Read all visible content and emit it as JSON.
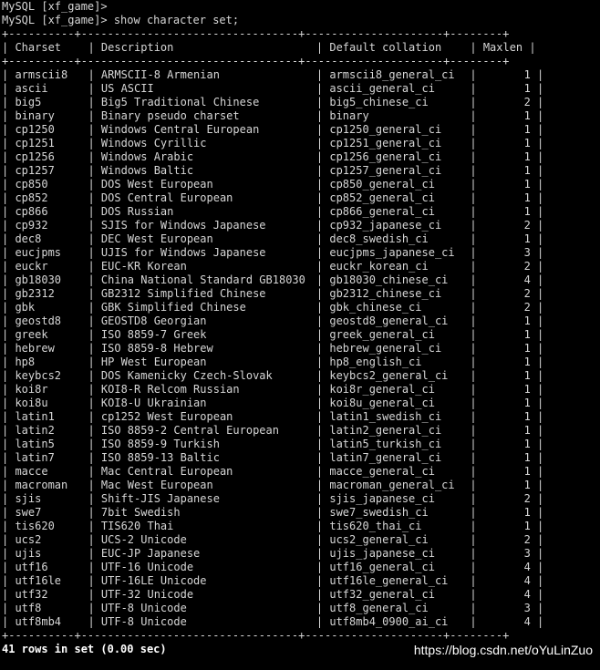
{
  "prompt_lines": [
    "MySQL [xf_game]>",
    "MySQL [xf_game]> show character set;"
  ],
  "table": {
    "border": "+----------+---------------------------------+---------------------+--------+",
    "headers": [
      "Charset",
      "Description",
      "Default collation",
      "Maxlen"
    ],
    "rows": [
      [
        "armscii8",
        "ARMSCII-8 Armenian",
        "armscii8_general_ci",
        "1"
      ],
      [
        "ascii",
        "US ASCII",
        "ascii_general_ci",
        "1"
      ],
      [
        "big5",
        "Big5 Traditional Chinese",
        "big5_chinese_ci",
        "2"
      ],
      [
        "binary",
        "Binary pseudo charset",
        "binary",
        "1"
      ],
      [
        "cp1250",
        "Windows Central European",
        "cp1250_general_ci",
        "1"
      ],
      [
        "cp1251",
        "Windows Cyrillic",
        "cp1251_general_ci",
        "1"
      ],
      [
        "cp1256",
        "Windows Arabic",
        "cp1256_general_ci",
        "1"
      ],
      [
        "cp1257",
        "Windows Baltic",
        "cp1257_general_ci",
        "1"
      ],
      [
        "cp850",
        "DOS West European",
        "cp850_general_ci",
        "1"
      ],
      [
        "cp852",
        "DOS Central European",
        "cp852_general_ci",
        "1"
      ],
      [
        "cp866",
        "DOS Russian",
        "cp866_general_ci",
        "1"
      ],
      [
        "cp932",
        "SJIS for Windows Japanese",
        "cp932_japanese_ci",
        "2"
      ],
      [
        "dec8",
        "DEC West European",
        "dec8_swedish_ci",
        "1"
      ],
      [
        "eucjpms",
        "UJIS for Windows Japanese",
        "eucjpms_japanese_ci",
        "3"
      ],
      [
        "euckr",
        "EUC-KR Korean",
        "euckr_korean_ci",
        "2"
      ],
      [
        "gb18030",
        "China National Standard GB18030",
        "gb18030_chinese_ci",
        "4"
      ],
      [
        "gb2312",
        "GB2312 Simplified Chinese",
        "gb2312_chinese_ci",
        "2"
      ],
      [
        "gbk",
        "GBK Simplified Chinese",
        "gbk_chinese_ci",
        "2"
      ],
      [
        "geostd8",
        "GEOSTD8 Georgian",
        "geostd8_general_ci",
        "1"
      ],
      [
        "greek",
        "ISO 8859-7 Greek",
        "greek_general_ci",
        "1"
      ],
      [
        "hebrew",
        "ISO 8859-8 Hebrew",
        "hebrew_general_ci",
        "1"
      ],
      [
        "hp8",
        "HP West European",
        "hp8_english_ci",
        "1"
      ],
      [
        "keybcs2",
        "DOS Kamenicky Czech-Slovak",
        "keybcs2_general_ci",
        "1"
      ],
      [
        "koi8r",
        "KOI8-R Relcom Russian",
        "koi8r_general_ci",
        "1"
      ],
      [
        "koi8u",
        "KOI8-U Ukrainian",
        "koi8u_general_ci",
        "1"
      ],
      [
        "latin1",
        "cp1252 West European",
        "latin1_swedish_ci",
        "1"
      ],
      [
        "latin2",
        "ISO 8859-2 Central European",
        "latin2_general_ci",
        "1"
      ],
      [
        "latin5",
        "ISO 8859-9 Turkish",
        "latin5_turkish_ci",
        "1"
      ],
      [
        "latin7",
        "ISO 8859-13 Baltic",
        "latin7_general_ci",
        "1"
      ],
      [
        "macce",
        "Mac Central European",
        "macce_general_ci",
        "1"
      ],
      [
        "macroman",
        "Mac West European",
        "macroman_general_ci",
        "1"
      ],
      [
        "sjis",
        "Shift-JIS Japanese",
        "sjis_japanese_ci",
        "2"
      ],
      [
        "swe7",
        "7bit Swedish",
        "swe7_swedish_ci",
        "1"
      ],
      [
        "tis620",
        "TIS620 Thai",
        "tis620_thai_ci",
        "1"
      ],
      [
        "ucs2",
        "UCS-2 Unicode",
        "ucs2_general_ci",
        "2"
      ],
      [
        "ujis",
        "EUC-JP Japanese",
        "ujis_japanese_ci",
        "3"
      ],
      [
        "utf16",
        "UTF-16 Unicode",
        "utf16_general_ci",
        "4"
      ],
      [
        "utf16le",
        "UTF-16LE Unicode",
        "utf16le_general_ci",
        "4"
      ],
      [
        "utf32",
        "UTF-32 Unicode",
        "utf32_general_ci",
        "4"
      ],
      [
        "utf8",
        "UTF-8 Unicode",
        "utf8_general_ci",
        "3"
      ],
      [
        "utf8mb4",
        "UTF-8 Unicode",
        "utf8mb4_0900_ai_ci",
        "4"
      ]
    ]
  },
  "summary": "41 rows in set (0.00 sec)",
  "watermark": "https://blog.csdn.net/oYuLinZuo",
  "colors": {
    "background": "#000000",
    "text": "#d6d6d6",
    "summary": "#ffffff"
  }
}
